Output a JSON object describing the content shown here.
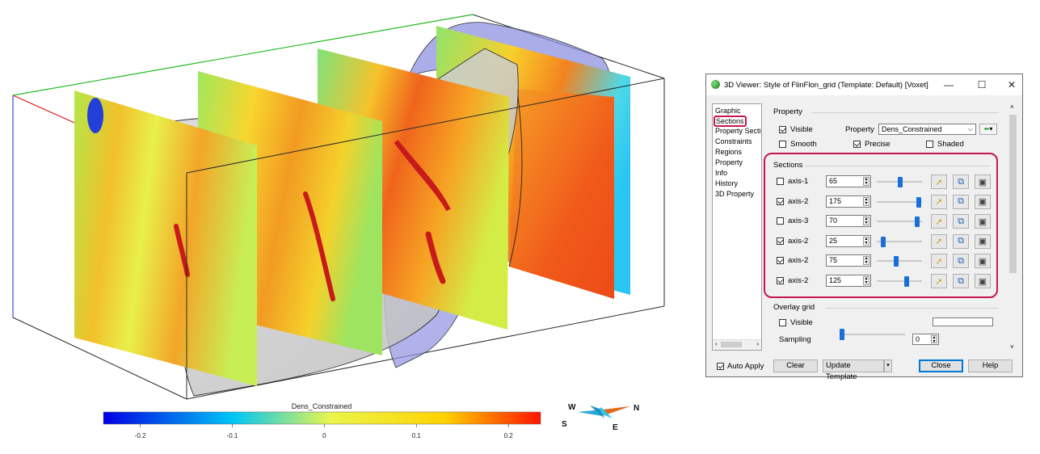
{
  "colorbar": {
    "title": "Dens_Constrained",
    "ticks": [
      "-0.2",
      "-0.1",
      "0",
      "0.1",
      "0.2"
    ],
    "tick_values": [
      -0.2,
      -0.1,
      0,
      0.1,
      0.2
    ],
    "range": [
      -0.24,
      0.235
    ],
    "colors": [
      "#0000e6",
      "#00c8f5",
      "#eaf64b",
      "#ffd200",
      "#ff1400"
    ]
  },
  "compass": {
    "west": "W",
    "north": "N",
    "south": "S",
    "east": "E"
  },
  "dialog": {
    "title": "3D Viewer: Style of FlinFlon_grid (Template: Default) [Voxet]",
    "minimize": "—",
    "maximize": "☐",
    "close": "✕",
    "nav": [
      "Graphic",
      "Sections",
      "Property Secti",
      "Constraints",
      "Regions",
      "Property",
      "Info",
      "History",
      "3D Property"
    ],
    "nav_selected": "Sections",
    "property_group": {
      "title": "Property",
      "visible_label": "Visible",
      "visible_checked": true,
      "property_label": "Property",
      "property_value": "Dens_Constrained",
      "smooth_label": "Smooth",
      "smooth_checked": false,
      "precise_label": "Precise",
      "precise_checked": true,
      "shaded_label": "Shaded",
      "shaded_checked": false
    },
    "sections_group": {
      "title": "Sections",
      "rows": [
        {
          "axis": "axis-1",
          "checked": false,
          "value": "65",
          "slider": 0.52
        },
        {
          "axis": "axis-2",
          "checked": true,
          "value": "175",
          "slider": 0.92
        },
        {
          "axis": "axis-3",
          "checked": false,
          "value": "70",
          "slider": 0.9
        },
        {
          "axis": "axis-2",
          "checked": true,
          "value": "25",
          "slider": 0.14
        },
        {
          "axis": "axis-2",
          "checked": true,
          "value": "75",
          "slider": 0.42
        },
        {
          "axis": "axis-2",
          "checked": true,
          "value": "125",
          "slider": 0.66
        }
      ]
    },
    "overlay_group": {
      "title": "Overlay grid",
      "visible_label": "Visible",
      "visible_checked": false,
      "sampling_label": "Sampling",
      "sampling_value": "0"
    },
    "footer": {
      "auto_apply_label": "Auto Apply",
      "auto_apply_checked": true,
      "clear": "Clear",
      "update_template": "Update Template",
      "close": "Close",
      "help": "Help"
    }
  }
}
